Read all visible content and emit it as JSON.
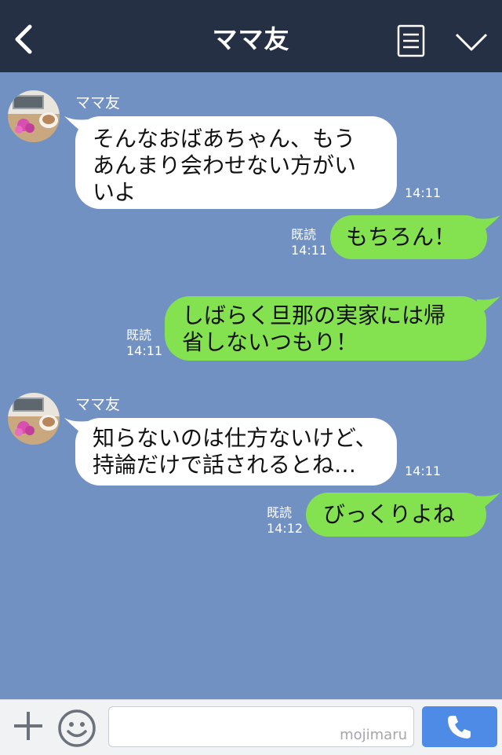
{
  "header": {
    "title": "ママ友",
    "back_icon": "chevron-left-icon",
    "menu_icon": "list-icon",
    "collapse_icon": "chevron-down-icon"
  },
  "messages": [
    {
      "type": "in",
      "sender": "ママ友",
      "lines": [
        "そんなおばあちゃん、もう",
        "あんまり会わせない方がい",
        "いよ"
      ],
      "time": "14:11"
    },
    {
      "type": "out",
      "read": "既読",
      "lines": [
        "もちろん！"
      ],
      "time": "14:11"
    },
    {
      "type": "out",
      "read": "既読",
      "lines": [
        "しばらく旦那の実家には帰",
        "省しないつもり！"
      ],
      "time": "14:11"
    },
    {
      "type": "in",
      "sender": "ママ友",
      "lines": [
        "知らないのは仕方ないけど、",
        "持論だけで話されるとね…"
      ],
      "time": "14:11"
    },
    {
      "type": "out",
      "read": "既読",
      "lines": [
        "びっくりよね"
      ],
      "time": "14:12"
    }
  ],
  "footer": {
    "input_value": "",
    "watermark": "mojimaru",
    "plus_icon": "plus-icon",
    "emoji_icon": "smiley-icon",
    "call_icon": "phone-icon"
  },
  "colors": {
    "header_bg": "#253044",
    "chat_bg": "#7191c2",
    "incoming_bubble": "#ffffff",
    "outgoing_bubble": "#84e250",
    "call_button": "#4d8be6"
  }
}
